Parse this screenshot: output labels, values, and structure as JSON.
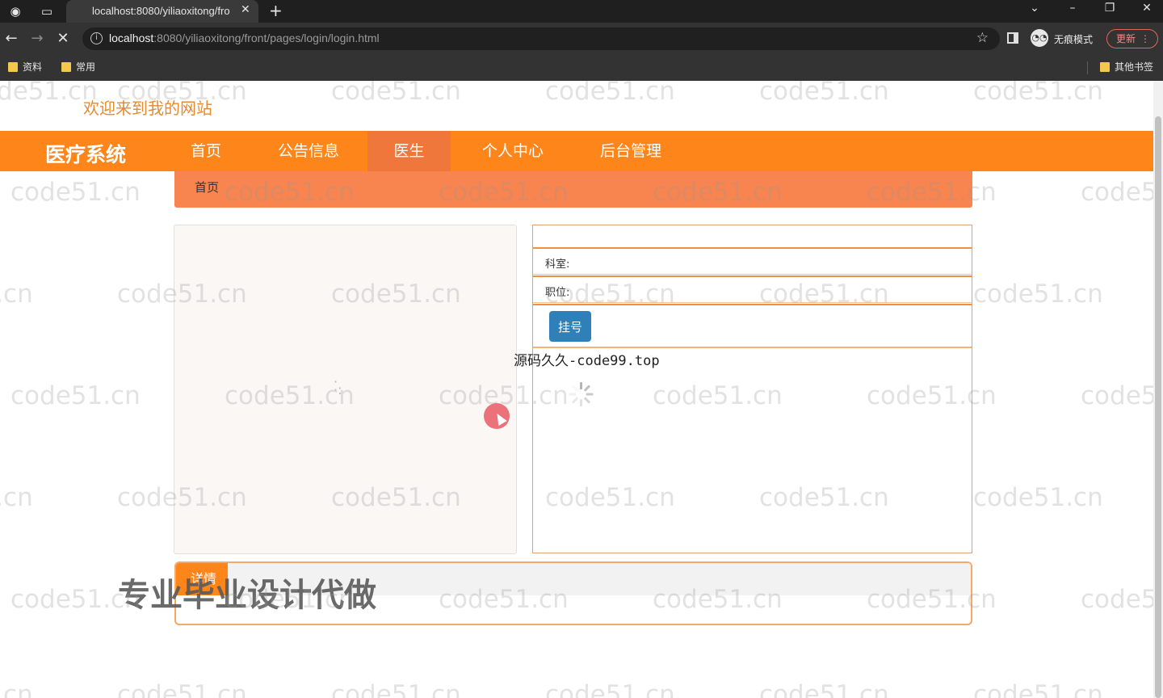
{
  "browser": {
    "tab_title": "localhost:8080/yiliaoxitong/fro",
    "url_host": "localhost",
    "url_rest": ":8080/yiliaoxitong/front/pages/login/login.html",
    "incognito_label": "无痕模式",
    "update_label": "更新",
    "bookmarks": [
      "资料",
      "常用"
    ],
    "other_bookmarks": "其他书签"
  },
  "page": {
    "welcome": "欢迎来到我的网站",
    "brand": "医疗系统",
    "nav": [
      "首页",
      "公告信息",
      "医生",
      "个人中心",
      "后台管理"
    ],
    "active_nav": "医生",
    "breadcrumb": "首页",
    "fields": {
      "department_label": "科室:",
      "position_label": "职位:"
    },
    "register_button": "挂号",
    "bottom_tag": "详情",
    "promo_text": "专业毕业设计代做",
    "overlay_code": "源码久久-code99.top",
    "watermark": "code51.cn"
  },
  "colors": {
    "nav_bg": "#fe8519",
    "nav_active": "#f0773c",
    "breadcrumb_bg": "#f8844f",
    "button_blue": "#2f7fb9",
    "welcome_text": "#e58a2e"
  }
}
